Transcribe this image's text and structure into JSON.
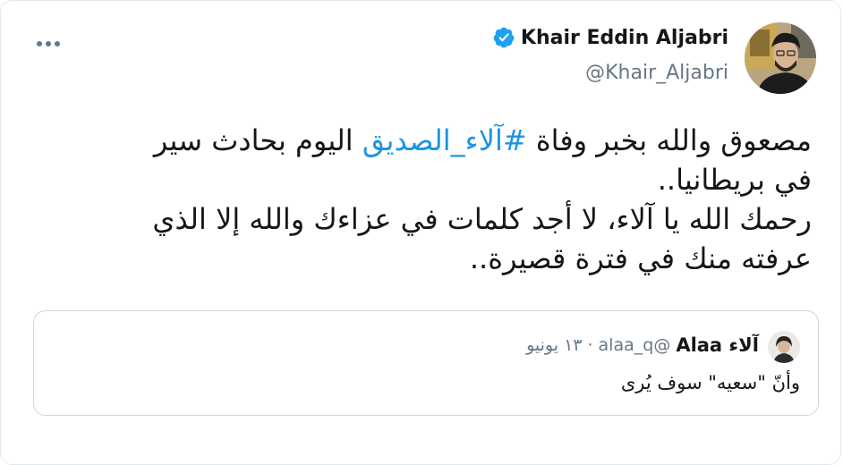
{
  "colors": {
    "link": "#1b95e0",
    "text": "#14171a",
    "secondary": "#657786",
    "border": "#e1e8ed",
    "verified": "#1da1f2"
  },
  "author": {
    "display_name": "Khair Eddin Aljabri",
    "handle": "@Khair_Aljabri",
    "verified_icon": "verified-badge-icon",
    "avatar_icon": "avatar-photo"
  },
  "menu": {
    "icon": "more-dots-icon"
  },
  "tweet": {
    "line1_before": "مصعوق والله بخبر وفاة ",
    "hashtag": "#آلاء_الصديق",
    "line1_after": " اليوم بحادث سير",
    "line2": "في بريطانيا..",
    "line3": "رحمك الله يا آلاء، لا أجد كلمات في عزاءك والله إلا الذي",
    "line4": "عرفته منك في فترة قصيرة.."
  },
  "quoted": {
    "name": "آلاء Alaa",
    "handle": "@alaa_q",
    "separator": "·",
    "date": "١٣ يونيو",
    "text": "وأنّ \"سعيه\" سوف يُرى",
    "avatar_icon": "avatar-photo"
  }
}
